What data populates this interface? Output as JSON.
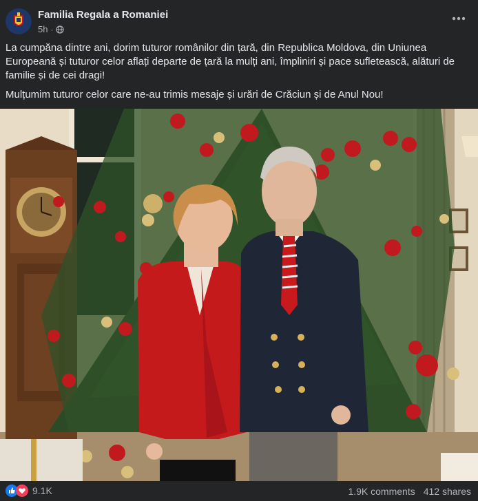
{
  "post": {
    "page_name": "Familia Regala a Romaniei",
    "time": "5h",
    "audience_icon": "globe-icon",
    "text_1": "La cumpăna dintre ani, dorim tuturor românilor din țară, din Republica Moldova, din Uniunea Europeană și tuturor celor aflați departe de țară la mulți ani, împliniri și pace sufletească, alături de familie și de cei dragi!",
    "text_2": "Mulțumim tuturor celor care ne-au trimis mesaje și urări de Crăciun și de Anul Nou!"
  },
  "footer": {
    "reaction_count": "9.1K",
    "comments": "1.9K comments",
    "shares": "412 shares"
  },
  "colors": {
    "background": "#242526",
    "like_blue": "#1877f2",
    "love_red": "#f33e58"
  }
}
